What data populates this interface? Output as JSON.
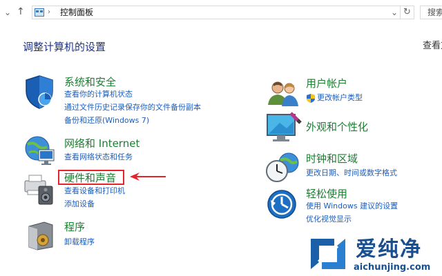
{
  "address_bar": {
    "path": "控制面板",
    "search_partial": "搜索"
  },
  "page_title": "调整计算机的设置",
  "view_by": "查看方",
  "categories_left": [
    {
      "title": "系统和安全",
      "links": [
        "查看你的计算机状态",
        "通过文件历史记录保存你的文件备份副本",
        "备份和还原(Windows 7)"
      ]
    },
    {
      "title": "网络和 Internet",
      "links": [
        "查看网络状态和任务"
      ]
    },
    {
      "title": "硬件和声音",
      "links": [
        "查看设备和打印机",
        "添加设备"
      ]
    },
    {
      "title": "程序",
      "links": [
        "卸载程序"
      ]
    }
  ],
  "categories_right": [
    {
      "title": "用户帐户",
      "links": [
        "更改帐户类型"
      ]
    },
    {
      "title": "外观和个性化",
      "links": []
    },
    {
      "title": "时钟和区域",
      "links": [
        "更改日期、时间或数字格式"
      ]
    },
    {
      "title": "轻松使用",
      "links": [
        "使用 Windows 建议的设置",
        "优化视觉显示"
      ]
    }
  ],
  "watermark": {
    "brand": "爱纯净",
    "url": "aichunjing.com"
  },
  "colors": {
    "category_title": "#1b7e31",
    "link": "#1e5dbb",
    "page_title": "#1e3287",
    "highlight": "#e8222a"
  }
}
